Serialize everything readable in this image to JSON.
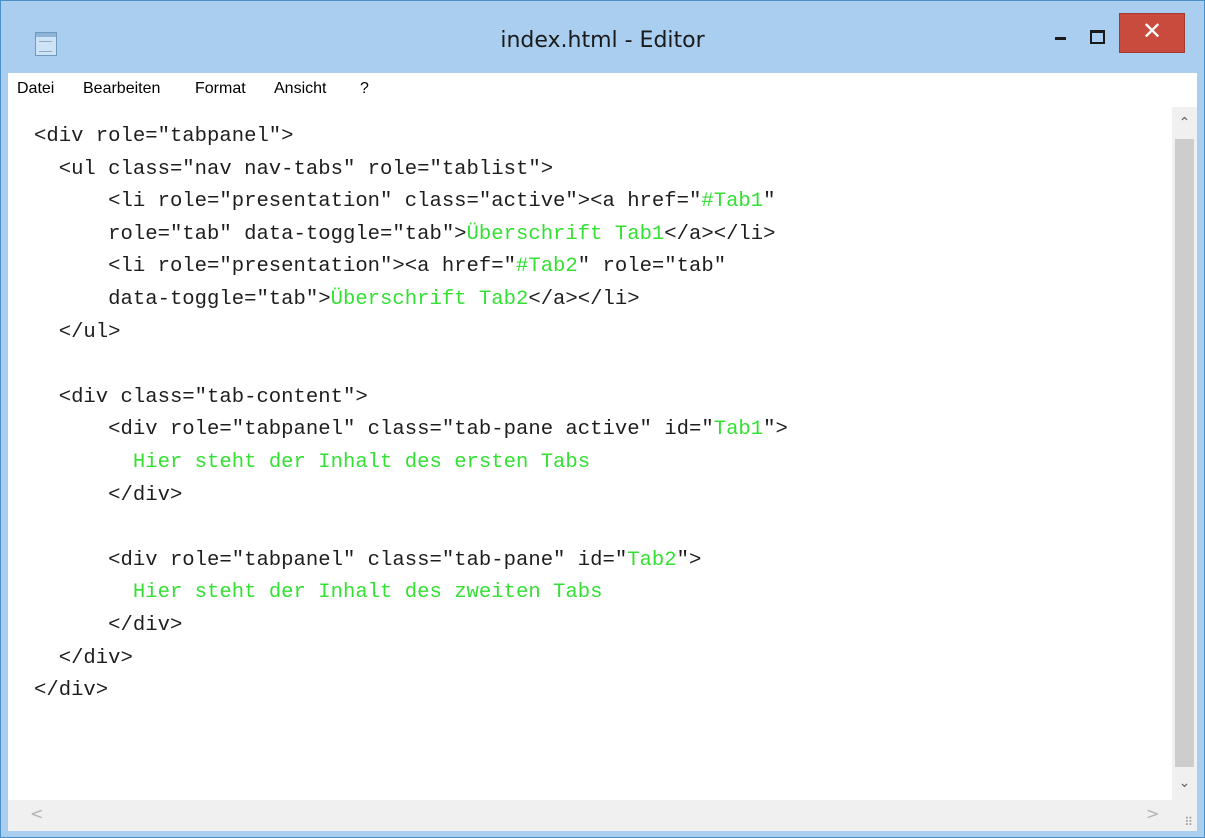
{
  "window": {
    "title": "index.html - Editor",
    "close_glyph": "✕"
  },
  "menu": [
    "Datei",
    "Bearbeiten",
    "Format",
    "Ansicht",
    "?"
  ],
  "code_lines": [
    [
      {
        "t": "<div role=\"tabpanel\">",
        "lit": false
      }
    ],
    [
      {
        "t": "  <ul class=\"nav nav-tabs\" role=\"tablist\">",
        "lit": false
      }
    ],
    [
      {
        "t": "      <li role=\"presentation\" class=\"active\"><a href=\"",
        "lit": false
      },
      {
        "t": "#Tab1",
        "lit": true
      },
      {
        "t": "\"",
        "lit": false
      }
    ],
    [
      {
        "t": "      role=\"tab\" data-toggle=\"tab\">",
        "lit": false
      },
      {
        "t": "Überschrift Tab1",
        "lit": true
      },
      {
        "t": "</a></li>",
        "lit": false
      }
    ],
    [
      {
        "t": "      <li role=\"presentation\"><a href=\"",
        "lit": false
      },
      {
        "t": "#Tab2",
        "lit": true
      },
      {
        "t": "\" role=\"tab\"",
        "lit": false
      }
    ],
    [
      {
        "t": "      data-toggle=\"tab\">",
        "lit": false
      },
      {
        "t": "Überschrift Tab2",
        "lit": true
      },
      {
        "t": "</a></li>",
        "lit": false
      }
    ],
    [
      {
        "t": "  </ul>",
        "lit": false
      }
    ],
    [
      {
        "t": "",
        "lit": false
      }
    ],
    [
      {
        "t": "  <div class=\"tab-content\">",
        "lit": false
      }
    ],
    [
      {
        "t": "      <div role=\"tabpanel\" class=\"tab-pane active\" id=\"",
        "lit": false
      },
      {
        "t": "Tab1",
        "lit": true
      },
      {
        "t": "\">",
        "lit": false
      }
    ],
    [
      {
        "t": "        ",
        "lit": false
      },
      {
        "t": "Hier steht der Inhalt des ersten Tabs",
        "lit": true
      }
    ],
    [
      {
        "t": "      </div>",
        "lit": false
      }
    ],
    [
      {
        "t": "",
        "lit": false
      }
    ],
    [
      {
        "t": "      <div role=\"tabpanel\" class=\"tab-pane\" id=\"",
        "lit": false
      },
      {
        "t": "Tab2",
        "lit": true
      },
      {
        "t": "\">",
        "lit": false
      }
    ],
    [
      {
        "t": "        ",
        "lit": false
      },
      {
        "t": "Hier steht der Inhalt des zweiten Tabs",
        "lit": true
      }
    ],
    [
      {
        "t": "      </div>",
        "lit": false
      }
    ],
    [
      {
        "t": "  </div>",
        "lit": false
      }
    ],
    [
      {
        "t": "</div>",
        "lit": false
      }
    ]
  ],
  "colors": {
    "title_bar": "#a9cef0",
    "close_button": "#c94b3e",
    "literal_text": "#33e033"
  },
  "icons": {
    "app": "notepad-icon",
    "minimize": "minimize-icon",
    "maximize": "maximize-icon",
    "close": "close-icon",
    "scroll_up": "chevron-up-icon",
    "scroll_down": "chevron-down-icon",
    "scroll_left": "chevron-left-icon",
    "scroll_right": "chevron-right-icon",
    "grip": "resize-grip-icon"
  }
}
